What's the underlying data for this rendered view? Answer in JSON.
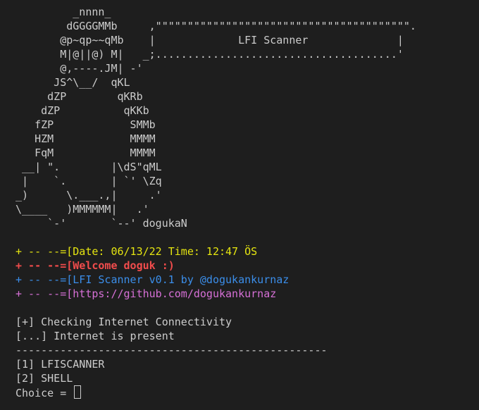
{
  "ascii_art": [
    "         _nnnn_",
    "        dGGGGMMb     ,\"\"\"\"\"\"\"\"\"\"\"\"\"\"\"\"\"\"\"\"\"\"\"\"\"\"\"\"\"\"\"\"\"\"\"\"\"\"\"\".",
    "       @p~qp~~qMb    |             LFI Scanner              |",
    "       M|@||@) M|   _;......................................'",
    "       @,----.JM| -'",
    "      JS^\\__/  qKL",
    "     dZP        qKRb",
    "    dZP          qKKb",
    "   fZP            SMMb",
    "   HZM            MMMM",
    "   FqM            MMMM",
    " __| \".        |\\dS\"qML",
    " |    `.       | `' \\Zq",
    "_)      \\.___.,|     .'",
    "\\____   )MMMMMM|   .'",
    "     `-'       `--' dogukaN"
  ],
  "banner": {
    "date_line": "+ -- --=[Date: 06/13/22 Time: 12:47 ÖS",
    "welcome_line": "+ -- --=[Welcome doguk :)",
    "version_line": "+ -- --=[LFI Scanner v0.1 by @dogukankurnaz",
    "github_line": "+ -- --=[https://github.com/dogukankurnaz"
  },
  "status": {
    "checking": "[+] Checking Internet Connectivity",
    "present": "[...] Internet is present"
  },
  "separator": "-------------------------------------------------",
  "menu": {
    "option1": "[1] LFISCANNER",
    "option2": "[2] SHELL",
    "prompt": "Choice = "
  },
  "colors": {
    "background": "#1e1e1e",
    "foreground": "#cccccc",
    "yellow": "#e5e510",
    "red": "#f14c4c",
    "blue": "#3b8eea",
    "magenta": "#d670d6"
  }
}
